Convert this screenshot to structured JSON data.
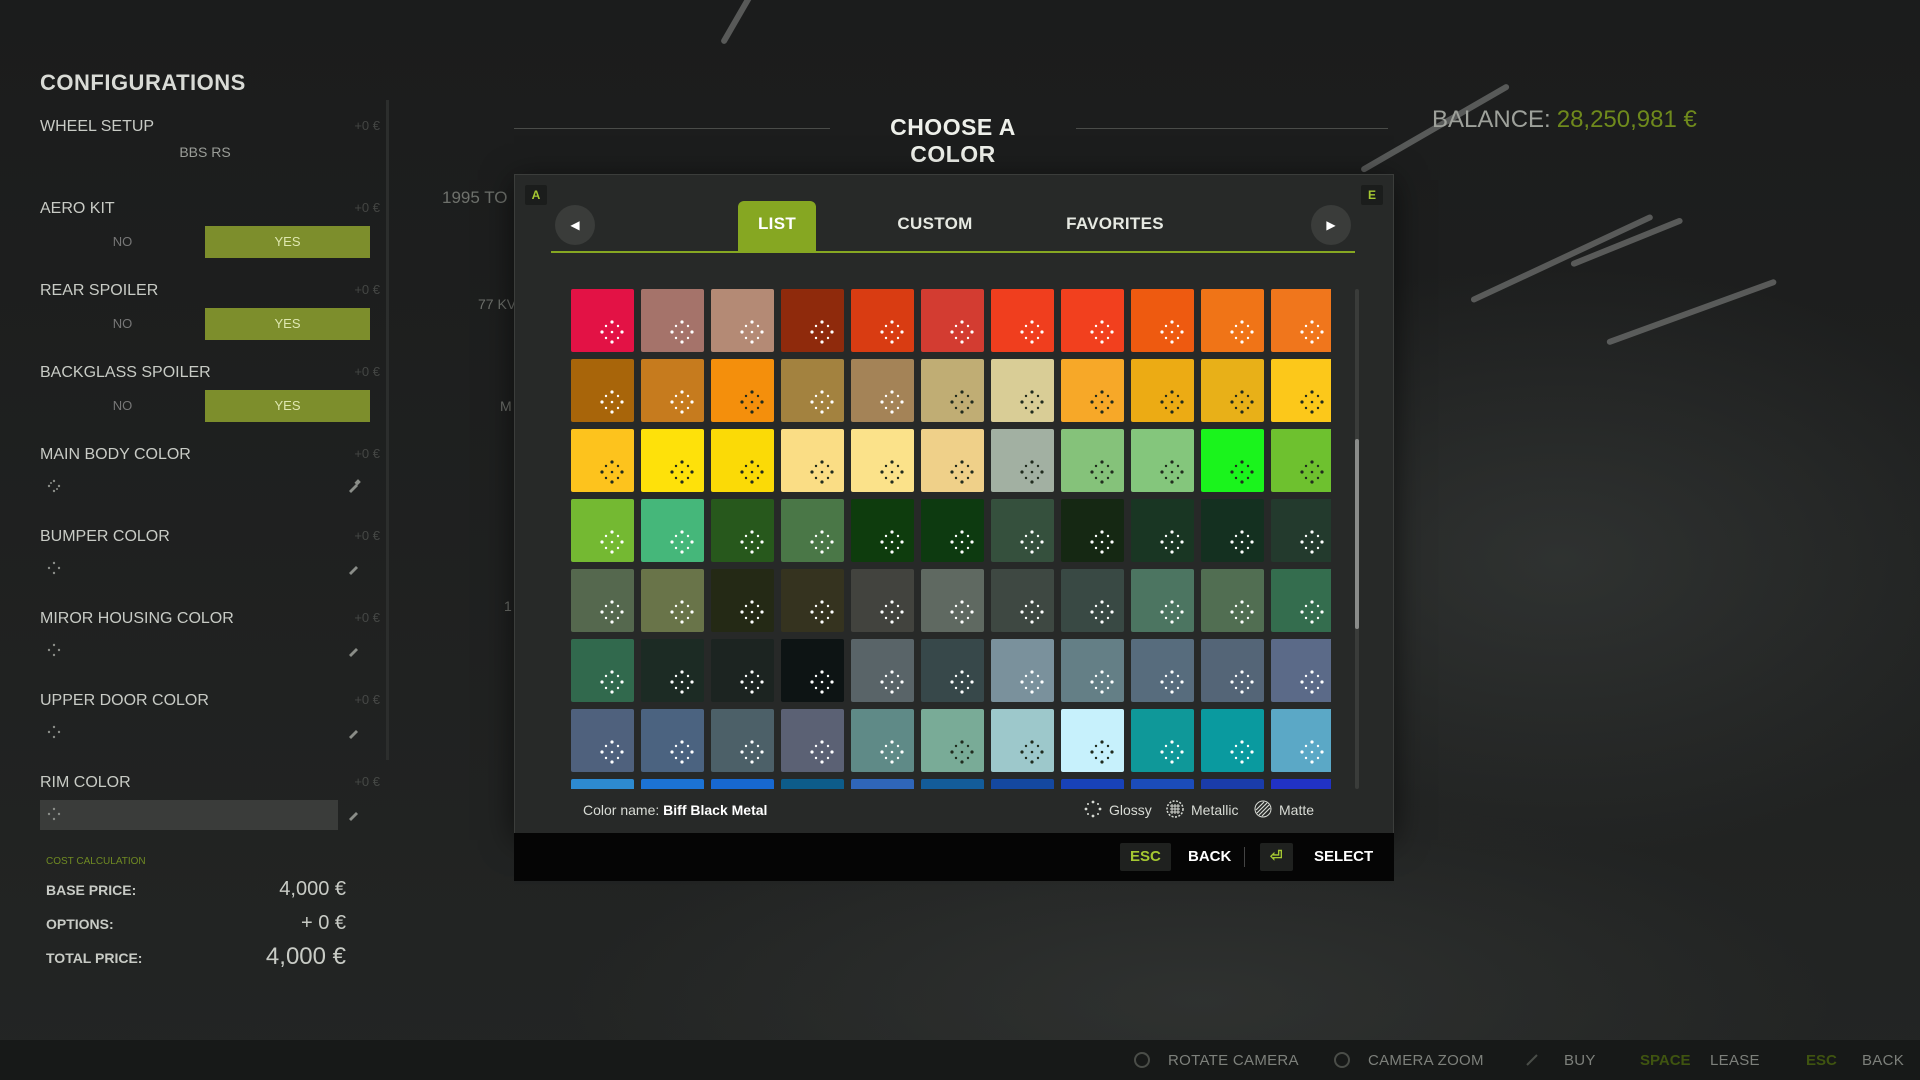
{
  "left_panel": {
    "title": "CONFIGURATIONS",
    "sections": [
      {
        "label": "WHEEL SETUP",
        "price": "+0 €",
        "value": "BBS RS"
      },
      {
        "label": "AERO KIT",
        "price": "+0 €",
        "no": "NO",
        "yes": "YES"
      },
      {
        "label": "REAR SPOILER",
        "price": "+0 €",
        "no": "NO",
        "yes": "YES"
      },
      {
        "label": "BACKGLASS SPOILER",
        "price": "+0 €",
        "no": "NO",
        "yes": "YES"
      },
      {
        "label": "MAIN BODY COLOR",
        "price": "+0 €"
      },
      {
        "label": "BUMPER COLOR",
        "price": "+0 €"
      },
      {
        "label": "MIROR HOUSING COLOR",
        "price": "+0 €"
      },
      {
        "label": "UPPER DOOR COLOR",
        "price": "+0 €"
      },
      {
        "label": "RIM COLOR",
        "price": "+0 €"
      }
    ],
    "cost": {
      "title": "COST CALCULATION",
      "base_label": "BASE PRICE:",
      "base_value": "4,000 €",
      "options_label": "OPTIONS:",
      "options_value": "+ 0 €",
      "total_label": "TOTAL PRICE:",
      "total_value": "4,000 €"
    }
  },
  "background": {
    "car_title": "1995 TO",
    "stat_1": "77 KV",
    "stat_2": "M",
    "stat_3": "1"
  },
  "balance": {
    "label": "BALANCE:",
    "value": "28,250,981 €"
  },
  "dialog": {
    "title": "CHOOSE A COLOR",
    "left_key": "A",
    "right_key": "E",
    "tabs": [
      "LIST",
      "CUSTOM",
      "FAVORITES"
    ],
    "active_tab": "LIST",
    "color_name_label": "Color name:",
    "color_name_value": "Biff Black Metal",
    "legend": [
      "Glossy",
      "Metallic",
      "Matte"
    ],
    "swatches": [
      [
        "#e31245",
        "#a5736a",
        "#b48a75",
        "#8f2a0c",
        "#d93c12",
        "#d33c31",
        "#f03e1e",
        "#f2401e",
        "#ee5a10",
        "#f07417",
        "#f0761c"
      ],
      [
        "#a8650a",
        "#c67b1e",
        "#f48f0c",
        "#a3823f",
        "#a48357",
        "#c0ad74",
        "#d9cd96",
        "#f7a828",
        "#ecab14",
        "#e8b018",
        "#fcc81a"
      ],
      [
        "#fdc31d",
        "#fee10a",
        "#fbda06",
        "#fadd85",
        "#fbe28a",
        "#efd089",
        "#a2b0a2",
        "#85c27a",
        "#84c67c",
        "#1af41c",
        "#6ec12f"
      ],
      [
        "#74b932",
        "#45b77a",
        "#27581c",
        "#4a7747",
        "#0e3c0d",
        "#0d3a10",
        "#35503d",
        "#152813",
        "#193623",
        "#143020",
        "#233a2d"
      ],
      [
        "#55684e",
        "#697449",
        "#242915",
        "#35331f",
        "#42433e",
        "#5f6961",
        "#3e4842",
        "#394944",
        "#4c7561",
        "#516e52",
        "#346d4e"
      ],
      [
        "#31694d",
        "#1c2b24",
        "#1c2421",
        "#0d1414",
        "#596468",
        "#37484a",
        "#7a919c",
        "#647f86",
        "#576c7d",
        "#546577",
        "#5b6a88"
      ],
      [
        "#4f617d",
        "#4b6380",
        "#4c6068",
        "#5b6174",
        "#5f8a87",
        "#79ab97",
        "#9dc8cb",
        "#c7f1fc",
        "#0f9899",
        "#0a9a9f",
        "#5ba8c6"
      ],
      [
        "#2d8ad0",
        "#1c73d4",
        "#1768d0",
        "#0d5c8a",
        "#2f66b9",
        "#135c99",
        "#1448a0",
        "#1842b8",
        "#1b4cba",
        "#1a3caa",
        "#2132c4"
      ]
    ],
    "footer": {
      "back_key": "ESC",
      "back_label": "BACK",
      "select_key": "⏎",
      "select_label": "SELECT"
    }
  },
  "bottom_bar": {
    "rotate": "ROTATE CAMERA",
    "zoom": "CAMERA ZOOM",
    "buy": "BUY",
    "lease_key": "SPACE",
    "lease": "LEASE",
    "back_key": "ESC",
    "back": "BACK"
  },
  "colors": {
    "accent": "#86a722",
    "balance_value": "#6f8a1c"
  }
}
